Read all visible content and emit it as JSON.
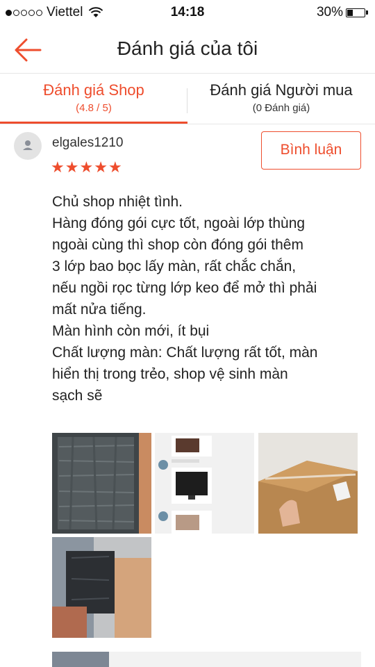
{
  "status_bar": {
    "carrier": "Viettel",
    "time": "14:18",
    "battery": "30%",
    "battery_level": 0.3,
    "signal_bars_filled": 1,
    "signal_bars_total": 5
  },
  "header": {
    "title": "Đánh giá của tôi",
    "back_icon": "arrow-left-icon"
  },
  "tabs": [
    {
      "label": "Đánh giá Shop",
      "sub": "(4.8 / 5)",
      "active": true
    },
    {
      "label": "Đánh giá Người mua",
      "sub": "(0 Đánh giá)",
      "active": false
    }
  ],
  "review": {
    "username": "elgales1210",
    "rating": 5,
    "comment_button": "Bình luận",
    "lines": [
      "Chủ shop nhiệt tình.",
      "Hàng đóng gói cực tốt, ngoài lớp thùng",
      "ngoài cùng thì shop còn đóng gói thêm",
      "3 lớp bao bọc lấy màn, rất chắc chắn,",
      "nếu ngồi rọc từng lớp keo để mở thì phải",
      "mất nửa tiếng.",
      "Màn hình còn mới, ít bụi",
      "Chất lượng màn: Chất lượng rất tốt, màn",
      "hiển thị trong trẻo, shop vệ sinh màn",
      "sạch sẽ"
    ],
    "photo_count": 4
  },
  "colors": {
    "accent": "#ee4d2d",
    "text": "#222222",
    "divider": "#e6e6e6"
  }
}
